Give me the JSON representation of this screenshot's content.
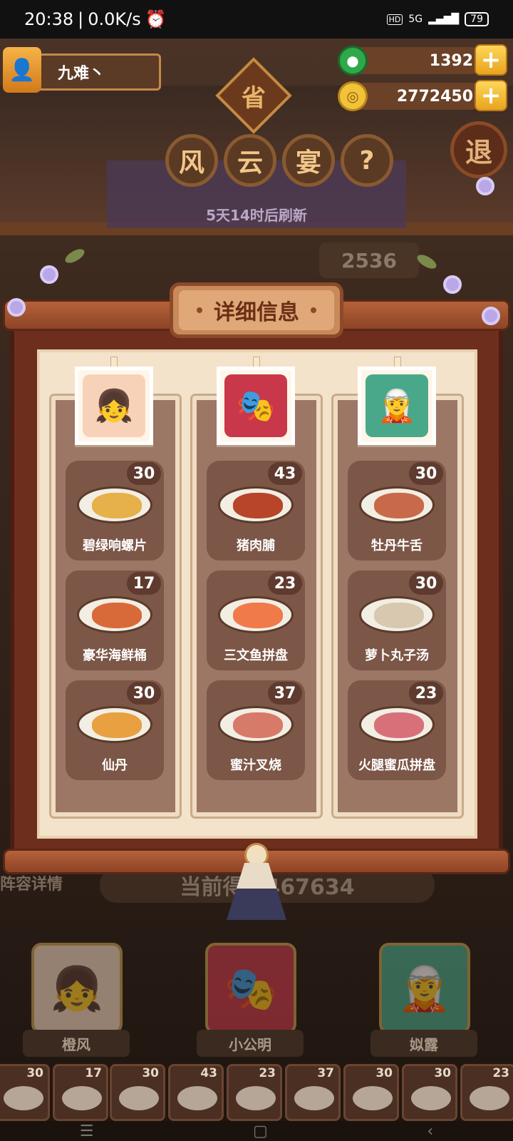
{
  "status_bar": {
    "time": "20:38",
    "speed": "0.0K/s",
    "network": "5G",
    "hd": "HD",
    "battery": "79"
  },
  "player": {
    "name": "九难丶"
  },
  "currencies": {
    "jade": "1392",
    "coins": "2772450"
  },
  "event": {
    "province_char": "省",
    "title_chars": [
      "风",
      "云",
      "宴"
    ],
    "help_char": "?",
    "refresh": "5天14时后刷新",
    "exit_char": "退",
    "rank_partial": "2536"
  },
  "modal": {
    "title": "详细信息",
    "columns": [
      {
        "character": "橙风",
        "dishes": [
          {
            "name": "碧绿响螺片",
            "score": "30",
            "color": "#e6b04a"
          },
          {
            "name": "豪华海鲜桶",
            "score": "17",
            "color": "#d86a3a"
          },
          {
            "name": "仙丹",
            "score": "30",
            "color": "#e8a040"
          }
        ]
      },
      {
        "character": "小公明",
        "dishes": [
          {
            "name": "猪肉脯",
            "score": "43",
            "color": "#b8442a"
          },
          {
            "name": "三文鱼拼盘",
            "score": "23",
            "color": "#f07a4a"
          },
          {
            "name": "蜜汁叉烧",
            "score": "37",
            "color": "#d87a6a"
          }
        ]
      },
      {
        "character": "姒露",
        "dishes": [
          {
            "name": "牡丹牛舌",
            "score": "30",
            "color": "#c86a4a"
          },
          {
            "name": "萝卜丸子汤",
            "score": "30",
            "color": "#d8c8b0"
          },
          {
            "name": "火腿蜜瓜拼盘",
            "score": "23",
            "color": "#d8707a"
          }
        ]
      }
    ]
  },
  "background": {
    "current_score": "当前得分467634",
    "lineup_label": "阵容详情"
  },
  "tray_scores": [
    "30",
    "17",
    "30",
    "43",
    "23",
    "37",
    "30",
    "30",
    "23"
  ],
  "colors": {
    "frame": "#6d2e1e",
    "paper": "#f4e3cb",
    "column": "#9c7766",
    "dish_card": "#7c5646",
    "accent_gold": "#e8a41c"
  }
}
